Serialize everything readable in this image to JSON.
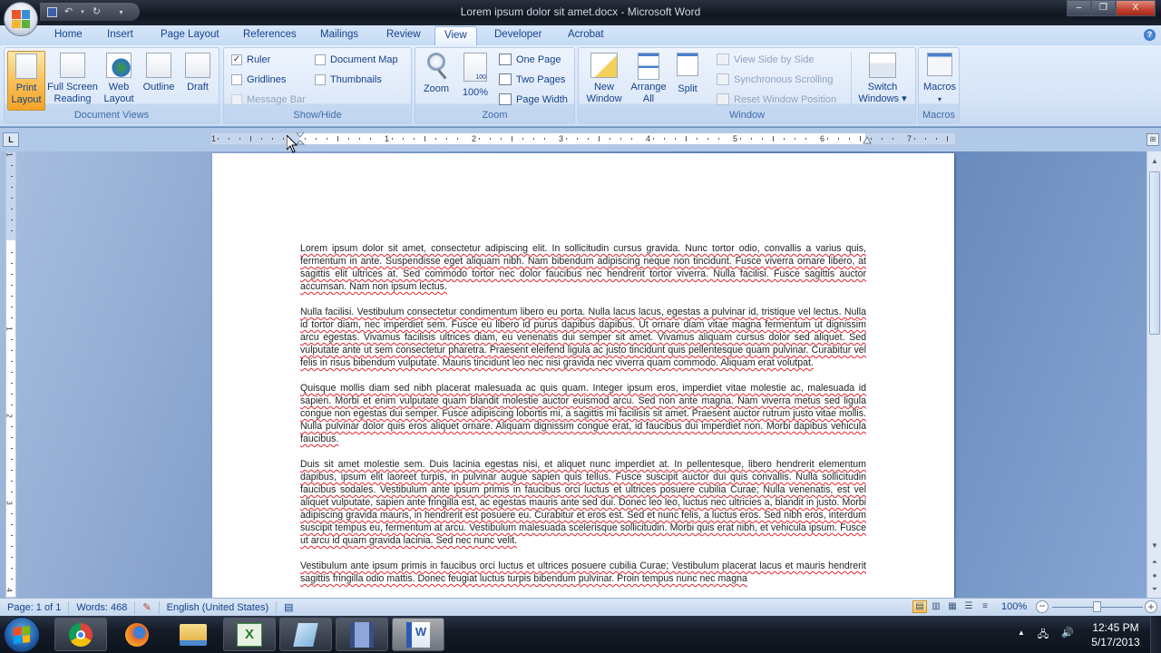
{
  "window": {
    "title": "Lorem ipsum dolor sit amet.docx - Microsoft Word",
    "controls": {
      "minimize": "–",
      "restore": "❐",
      "close": "X"
    }
  },
  "qat": {
    "save_icon": "save-icon",
    "undo_icon": "undo-icon",
    "redo_icon": "redo-icon",
    "customize_icon": "customize-icon"
  },
  "tabs": [
    {
      "label": "Home",
      "active": false
    },
    {
      "label": "Insert",
      "active": false
    },
    {
      "label": "Page Layout",
      "active": false
    },
    {
      "label": "References",
      "active": false
    },
    {
      "label": "Mailings",
      "active": false
    },
    {
      "label": "Review",
      "active": false
    },
    {
      "label": "View",
      "active": true
    },
    {
      "label": "Developer",
      "active": false
    },
    {
      "label": "Acrobat",
      "active": false
    }
  ],
  "help_label": "?",
  "ribbon": {
    "document_views": {
      "label": "Document Views",
      "buttons": [
        {
          "line1": "Print",
          "line2": "Layout",
          "active": true
        },
        {
          "line1": "Full Screen",
          "line2": "Reading",
          "active": false
        },
        {
          "line1": "Web",
          "line2": "Layout",
          "active": false
        },
        {
          "line1": "Outline",
          "line2": "",
          "active": false
        },
        {
          "line1": "Draft",
          "line2": "",
          "active": false
        }
      ]
    },
    "show_hide": {
      "label": "Show/Hide",
      "items": [
        {
          "label": "Ruler",
          "checked": true,
          "mark": "✓",
          "enabled": true
        },
        {
          "label": "Gridlines",
          "checked": false,
          "mark": "",
          "enabled": true
        },
        {
          "label": "Message Bar",
          "checked": false,
          "mark": "",
          "enabled": false
        },
        {
          "label": "Document Map",
          "checked": false,
          "mark": "",
          "enabled": true
        },
        {
          "label": "Thumbnails",
          "checked": false,
          "mark": "",
          "enabled": true
        }
      ]
    },
    "zoom": {
      "label": "Zoom",
      "zoom_button": "Zoom",
      "percent_button": "100%",
      "percent_icon_text": "100",
      "one_page": "One Page",
      "two_pages": "Two Pages",
      "page_width": "Page Width"
    },
    "window": {
      "label": "Window",
      "new_window": {
        "line1": "New",
        "line2": "Window"
      },
      "arrange_all": {
        "line1": "Arrange",
        "line2": "All"
      },
      "split": "Split",
      "view_side_by_side": "View Side by Side",
      "synchronous_scrolling": "Synchronous Scrolling",
      "reset_window_position": "Reset Window Position",
      "switch_windows": {
        "line1": "Switch",
        "line2": "Windows ▾"
      }
    },
    "macros": {
      "label": "Macros",
      "button": "Macros",
      "dropdown": "▾"
    }
  },
  "ruler": {
    "tab_selector": "L",
    "numbers": [
      "1",
      "1",
      "2",
      "3",
      "4",
      "5",
      "6",
      "7"
    ],
    "vertical_numbers": [
      "1",
      "1",
      "2",
      "3",
      "4"
    ]
  },
  "document": {
    "paragraphs": [
      "Lorem ipsum dolor sit amet, consectetur adipiscing elit. In sollicitudin cursus gravida. Nunc tortor odio, convallis a varius quis, fermentum in ante. Suspendisse eget aliquam nibh. Nam bibendum adipiscing neque non tincidunt. Fusce viverra ornare libero, at sagittis elit ultrices at. Sed commodo tortor nec dolor faucibus nec hendrerit tortor viverra. Nulla facilisi. Fusce sagittis auctor accumsan. Nam non ipsum lectus.",
      "Nulla facilisi. Vestibulum consectetur condimentum libero eu porta. Nulla lacus lacus, egestas a pulvinar id, tristique vel lectus. Nulla id tortor diam, nec imperdiet sem. Fusce eu libero id purus dapibus dapibus. Ut ornare diam vitae magna fermentum ut dignissim arcu egestas. Vivamus facilisis ultrices diam, eu venenatis dui semper sit amet. Vivamus aliquam cursus dolor sed aliquet. Sed vulputate ante ut sem consectetur pharetra. Praesent eleifend ligula ac justo tincidunt quis pellentesque quam pulvinar. Curabitur vel felis in risus bibendum vulputate. Mauris tincidunt leo nec nisi gravida nec viverra quam commodo. Aliquam erat volutpat.",
      "Quisque mollis diam sed nibh placerat malesuada ac quis quam. Integer ipsum eros, imperdiet vitae molestie ac, malesuada id sapien. Morbi et enim vulputate quam blandit molestie auctor euismod arcu. Sed non ante magna. Nam viverra metus sed ligula congue non egestas dui semper. Fusce adipiscing lobortis mi, a sagittis mi facilisis sit amet. Praesent auctor rutrum justo vitae mollis. Nulla pulvinar dolor quis eros aliquet ornare. Aliquam dignissim congue erat, id faucibus dui imperdiet non. Morbi dapibus vehicula faucibus.",
      "Duis sit amet molestie sem. Duis lacinia egestas nisi, et aliquet nunc imperdiet at. In pellentesque, libero hendrerit elementum dapibus, ipsum elit laoreet turpis, in pulvinar augue sapien quis tellus. Fusce suscipit auctor dui quis convallis. Nulla sollicitudin faucibus sodales. Vestibulum ante ipsum primis in faucibus orci luctus et ultrices posuere cubilia Curae; Nulla venenatis, est vel aliquet vulputate, sapien ante fringilla est, ac egestas mauris ante sed dui. Donec leo leo, luctus nec ultricies a, blandit in justo. Morbi adipiscing gravida mauris, in hendrerit est posuere eu. Curabitur et eros est. Sed et nunc felis, a luctus eros. Sed nibh eros, interdum suscipit tempus eu, fermentum at arcu. Vestibulum malesuada scelerisque sollicitudin. Morbi quis erat nibh, et vehicula ipsum. Fusce ut arcu id quam gravida lacinia. Sed nec nunc velit.",
      "Vestibulum ante ipsum primis in faucibus orci luctus et ultrices posuere cubilia Curae; Vestibulum placerat lacus et mauris hendrerit sagittis fringilla odio mattis. Donec feugiat luctus turpis bibendum pulvinar. Proin tempus nunc nec magna"
    ]
  },
  "statusbar": {
    "page": "Page: 1 of 1",
    "words": "Words: 468",
    "language": "English (United States)",
    "zoom": "100%",
    "zoom_fraction": 0.5
  },
  "taskbar": {
    "apps": [
      {
        "name": "chrome",
        "active": false
      },
      {
        "name": "firefox",
        "active": false
      },
      {
        "name": "windows-explorer",
        "active": false
      },
      {
        "name": "excel",
        "active": false
      },
      {
        "name": "notepad",
        "active": false
      },
      {
        "name": "movie-maker",
        "active": false
      },
      {
        "name": "word",
        "active": true
      }
    ],
    "time": "12:45 PM",
    "date": "5/17/2013",
    "tray_arrow": "▲",
    "speaker": "🔊"
  }
}
